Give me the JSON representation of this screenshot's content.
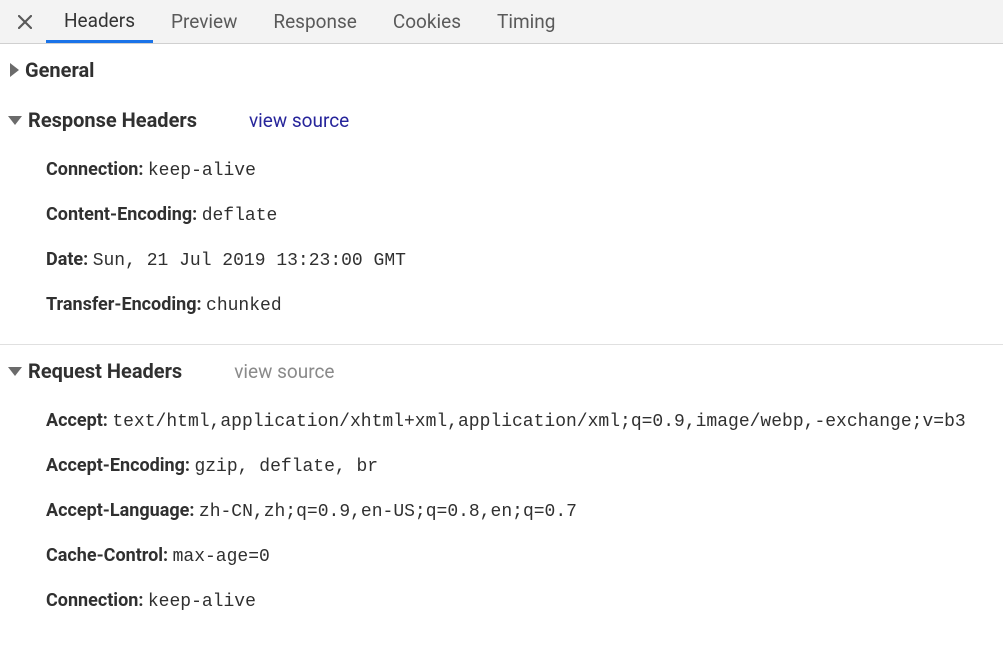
{
  "tabs": {
    "t0": "Headers",
    "t1": "Preview",
    "t2": "Response",
    "t3": "Cookies",
    "t4": "Timing"
  },
  "sections": {
    "general": {
      "title": "General"
    },
    "response": {
      "title": "Response Headers",
      "view_source": "view source",
      "rows": [
        {
          "name": "Connection:",
          "value": "keep-alive"
        },
        {
          "name": "Content-Encoding:",
          "value": "deflate"
        },
        {
          "name": "Date:",
          "value": "Sun, 21 Jul 2019 13:23:00 GMT"
        },
        {
          "name": "Transfer-Encoding:",
          "value": "chunked"
        }
      ]
    },
    "request": {
      "title": "Request Headers",
      "view_source": "view source",
      "rows": [
        {
          "name": "Accept:",
          "value": "text/html,application/xhtml+xml,application/xml;q=0.9,image/webp,-exchange;v=b3"
        },
        {
          "name": "Accept-Encoding:",
          "value": "gzip, deflate, br"
        },
        {
          "name": "Accept-Language:",
          "value": "zh-CN,zh;q=0.9,en-US;q=0.8,en;q=0.7"
        },
        {
          "name": "Cache-Control:",
          "value": "max-age=0"
        },
        {
          "name": "Connection:",
          "value": "keep-alive"
        }
      ]
    }
  }
}
